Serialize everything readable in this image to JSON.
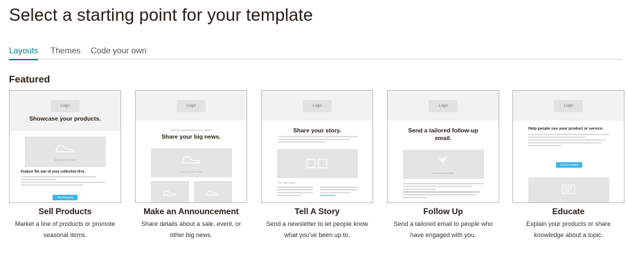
{
  "page": {
    "title": "Select a starting point for your template"
  },
  "tabs": [
    {
      "label": "Layouts",
      "active": true
    },
    {
      "label": "Themes",
      "active": false
    },
    {
      "label": "Code your own",
      "active": false
    }
  ],
  "section": {
    "title": "Featured"
  },
  "accent_color": "#007c89",
  "button_color": "#3fb6e8",
  "cards": [
    {
      "title": "Sell Products",
      "description": "Market a line of products or promote seasonal items.",
      "thumb": {
        "logo": "Logo",
        "headline": "Showcase your products.",
        "photo_label": "Add a photo here.",
        "subheading": "Feature the star of your collection first.",
        "button": "Start Shopping",
        "icon": "shoe-icon"
      }
    },
    {
      "title": "Make an Announcement",
      "description": "Share details about a sale, event, or other big news.",
      "thumb": {
        "logo": "Logo",
        "kicker": "Have an announcement to make?",
        "headline": "Share your big news.",
        "photo_label": "Add a photo here.",
        "icon": "shoe-icon"
      }
    },
    {
      "title": "Tell A Story",
      "description": "Send a newsletter to let people know what you've been up to.",
      "thumb": {
        "logo": "Logo",
        "headline": "Share your story.",
        "caption": "The main story",
        "icon": "image-icon"
      }
    },
    {
      "title": "Follow Up",
      "description": "Send a tailored email to people who have engaged with you.",
      "thumb": {
        "logo": "Logo",
        "headline": "Send a tailored follow-up email.",
        "photo_label": "Add a photo here.",
        "icon": "plant-icon"
      }
    },
    {
      "title": "Educate",
      "description": "Explain your products or share knowledge about a topic.",
      "thumb": {
        "logo": "Logo",
        "headline": "Help people use your product or service.",
        "button": "Let's Get Started",
        "icon": "document-icon"
      }
    }
  ]
}
